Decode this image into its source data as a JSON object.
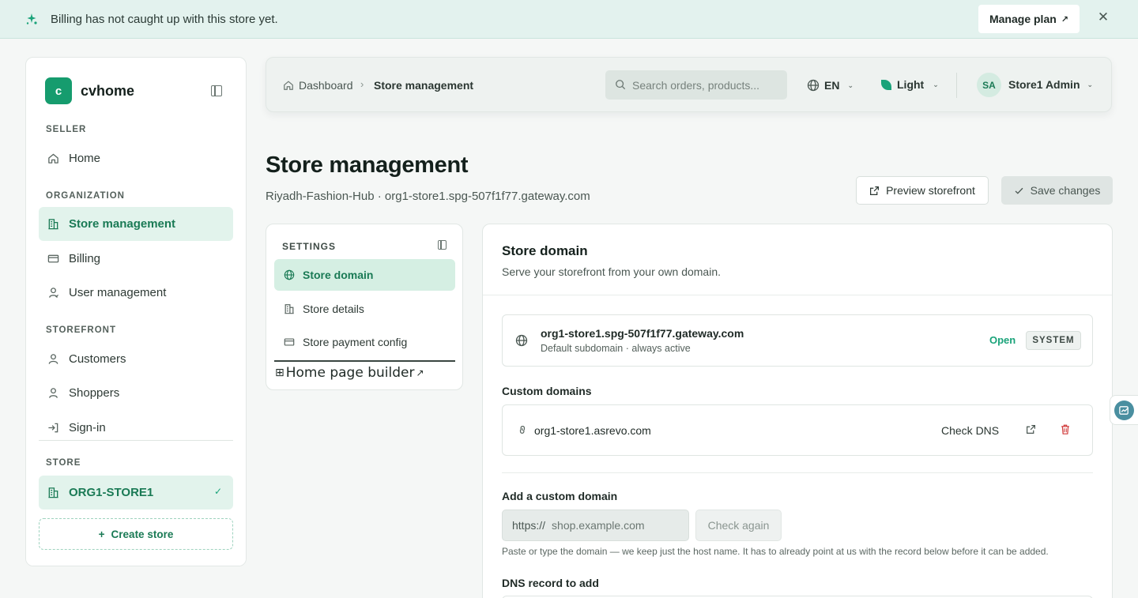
{
  "banner": {
    "message": "Billing has not caught up with this store yet.",
    "manage_plan_label": "Manage plan",
    "icon": "sparkle-icon"
  },
  "sidebar": {
    "logo_letter": "c",
    "brand": "cvhome",
    "sections": {
      "seller": "SELLER",
      "organization": "ORGANIZATION",
      "storefront": "STOREFRONT",
      "store": "STORE"
    },
    "items": [
      {
        "label": "Home",
        "icon": "home-icon",
        "active": false
      },
      {
        "label": "Store management",
        "icon": "building-icon",
        "active": true
      },
      {
        "label": "Billing",
        "icon": "credit-card-icon",
        "active": false
      },
      {
        "label": "User management",
        "icon": "user-badge-icon",
        "active": false
      },
      {
        "label": "Customers",
        "icon": "user-icon",
        "active": false
      },
      {
        "label": "Shoppers",
        "icon": "user-badge-icon",
        "active": false
      },
      {
        "label": "Sign-in",
        "icon": "sign-in-icon",
        "active": false
      }
    ],
    "current_store": "ORG1-STORE1",
    "create_store_label": "Create store"
  },
  "topbar": {
    "breadcrumb": [
      "Dashboard",
      "Store management"
    ],
    "search_placeholder": "Search orders, products...",
    "language": "EN",
    "theme": "Light",
    "avatar_initials": "SA",
    "user_name": "Store1 Admin"
  },
  "page": {
    "title": "Store management",
    "subtitle": "Riyadh-Fashion-Hub · org1-store1.spg-507f1f77.gateway.com",
    "preview_label": "Preview storefront",
    "save_label": "Save changes"
  },
  "settings": {
    "title": "SETTINGS",
    "items": [
      {
        "label": "Store domain",
        "icon": "globe-icon",
        "active": true
      },
      {
        "label": "Store details",
        "icon": "building-icon",
        "active": false
      },
      {
        "label": "Store payment config",
        "icon": "credit-card-icon",
        "active": false
      }
    ],
    "builder_label": "Home page builder"
  },
  "domain": {
    "title": "Store domain",
    "subtitle": "Serve your storefront from your own domain.",
    "default_domain": "org1-store1.spg-507f1f77.gateway.com",
    "default_desc": "Default subdomain · always active",
    "status": "Open",
    "badge": "SYSTEM",
    "custom_domains_label": "Custom domains",
    "custom_domains": [
      {
        "host": "org1-store1.asrevo.com",
        "action": "Check DNS"
      }
    ],
    "add_label": "Add a custom domain",
    "add_prefix": "https://",
    "add_placeholder": "shop.example.com",
    "check_again_label": "Check again",
    "help_text": "Paste or type the domain — we keep just the host name. It has to already point at us with the record below before it can be added.",
    "dns_record_label": "DNS record to add"
  },
  "colors": {
    "accent": "#1aa37a",
    "accent_dark": "#1a7a55",
    "danger": "#d13b3b",
    "banner_bg": "#e3f2ee"
  }
}
